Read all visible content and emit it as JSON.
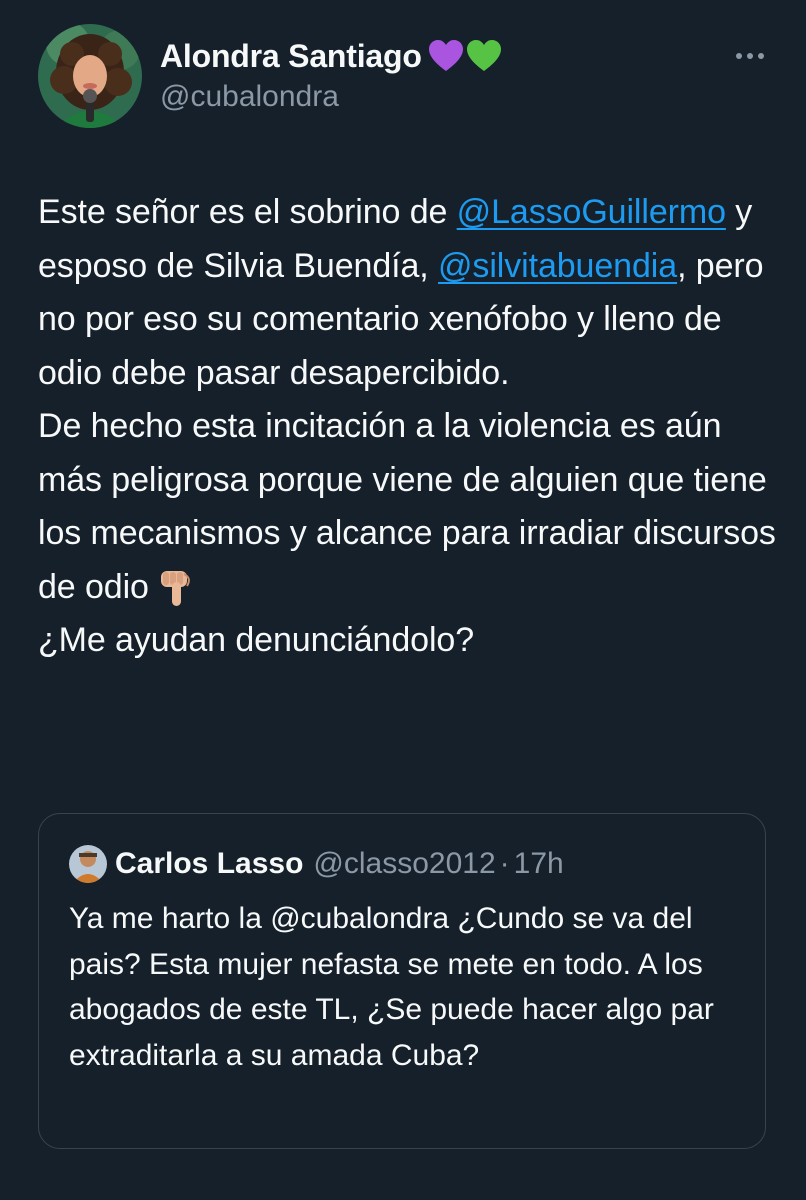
{
  "tweet": {
    "author": {
      "display_name": "Alondra Santiago",
      "handle": "@cubalondra",
      "name_emojis": [
        "purple-heart",
        "green-heart"
      ]
    },
    "more_icon": "more-horizontal-icon",
    "body": {
      "p1_a": "Este señor es el sobrino de ",
      "mention_1": "@LassoGuillermo",
      "p1_b": " y esposo de Silvia Buendía, ",
      "mention_2": "@silvitabuendia",
      "p1_c": ", pero no por eso su comentario xenófobo y lleno de odio debe pasar desapercibido.",
      "p2": "De hecho esta incitación a la violencia es aún más peligrosa porque viene de alguien que tiene los mecanismos y alcance para irradiar discursos de odio",
      "p2_emoji": "backhand-index-pointing-down",
      "p3": "¿Me ayudan denunciándolo?"
    },
    "quoted": {
      "display_name": "Carlos Lasso",
      "handle": "@classo2012",
      "separator": "·",
      "time": "17h",
      "text": "Ya me harto la @cubalondra ¿Cundo se va del pais? Esta mujer nefasta se mete en todo. A los abogados de este TL, ¿Se puede hacer algo par extraditarla a su amada Cuba?"
    }
  },
  "colors": {
    "background": "#15202b",
    "text": "#f7f9f9",
    "secondary": "#8b98a5",
    "link": "#1d9bf0",
    "border": "#38444d"
  }
}
